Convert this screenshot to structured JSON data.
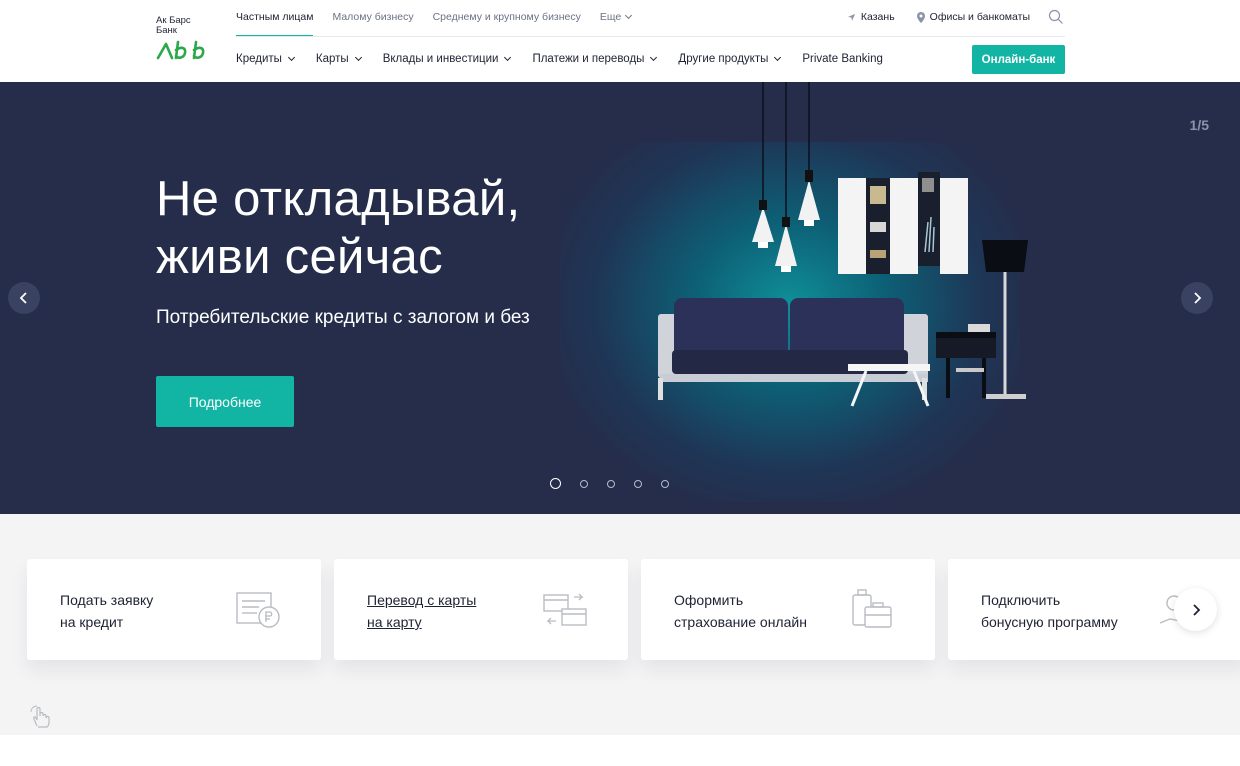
{
  "header": {
    "logo": {
      "line1": "Ак Барс",
      "line2": "Банк"
    },
    "segments": [
      {
        "label": "Частным лицам",
        "active": true
      },
      {
        "label": "Малому бизнесу"
      },
      {
        "label": "Среднему и крупному бизнесу"
      },
      {
        "label": "Еще",
        "dropdown": true
      }
    ],
    "city": "Казань",
    "offices": "Офисы и банкоматы",
    "nav": [
      {
        "label": "Кредиты",
        "dropdown": true
      },
      {
        "label": "Карты",
        "dropdown": true
      },
      {
        "label": "Вклады и инвестиции",
        "dropdown": true
      },
      {
        "label": "Платежи и переводы",
        "dropdown": true
      },
      {
        "label": "Другие продукты",
        "dropdown": true
      },
      {
        "label": "Private Banking",
        "dropdown": false
      }
    ],
    "online_bank": "Онлайн-банк"
  },
  "hero": {
    "title": "Не откладывай, живи сейчас",
    "subtitle": "Потребительские кредиты с залогом и без",
    "button": "Подробнее",
    "counter": "1/5",
    "slides_total": 5,
    "active_slide": 1
  },
  "quick_actions": [
    {
      "line1": "Подать заявку",
      "line2": "на кредит",
      "icon": "credit-application-icon",
      "link": false
    },
    {
      "line1": "Перевод с карты",
      "line2": "на карту",
      "icon": "card-transfer-icon",
      "link": true
    },
    {
      "line1": "Оформить",
      "line2": "страхование онлайн",
      "icon": "luggage-insurance-icon",
      "link": false
    },
    {
      "line1": "Подключить",
      "line2": "бонусную программу",
      "icon": "bonus-program-icon",
      "link": false
    }
  ],
  "colors": {
    "accent": "#12b5a3",
    "hero_bg": "#252d4a",
    "text": "#1e2233",
    "logo_green": "#2aa84a"
  }
}
